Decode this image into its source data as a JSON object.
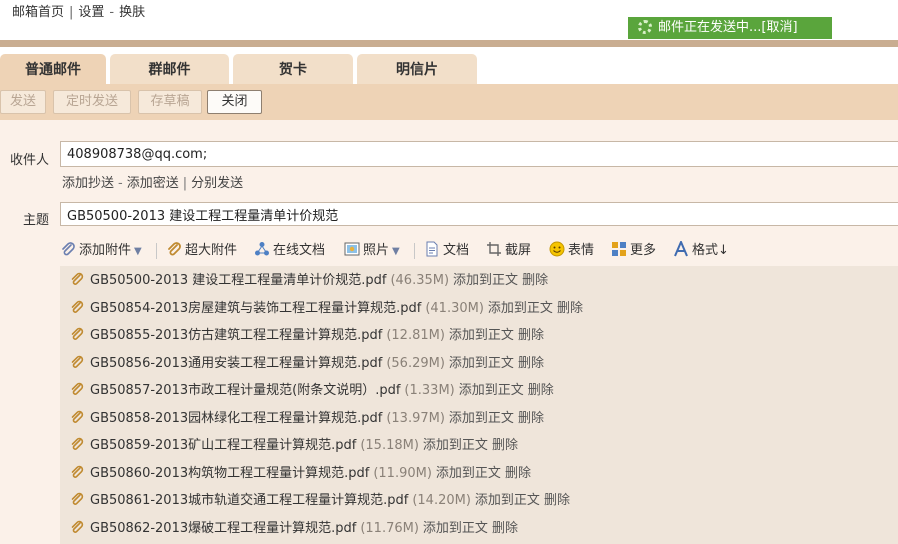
{
  "header": {
    "links": [
      {
        "label": "邮箱首页"
      },
      {
        "label": "设置"
      },
      {
        "label": "换肤"
      }
    ],
    "sep1": "|",
    "sep2": "-",
    "sending_text": "邮件正在发送中...",
    "cancel_label": "[取消]"
  },
  "tabs": [
    {
      "label": "普通邮件",
      "active": true
    },
    {
      "label": "群邮件"
    },
    {
      "label": "贺卡"
    },
    {
      "label": "明信片"
    }
  ],
  "toolbar": {
    "send": "发送",
    "scheduled_send": "定时发送",
    "save_draft": "存草稿",
    "close": "关闭"
  },
  "compose": {
    "to_label": "收件人",
    "to_value": "408908738@qq.com;",
    "add_cc": "添加抄送",
    "add_bcc": "添加密送",
    "separate_send": "分别发送",
    "link_sep_dash": "-",
    "link_sep_bar": "|",
    "subject_label": "主题",
    "subject_value": "GB50500-2013 建设工程工程量清单计价规范"
  },
  "attach_toolbar": {
    "add_attachment": "添加附件",
    "large_attachment": "超大附件",
    "online_docs": "在线文档",
    "photo": "照片",
    "document": "文档",
    "screenshot": "截屏",
    "emoji": "表情",
    "more": "更多",
    "format": "格式↓"
  },
  "attachments": {
    "add_to_body": "添加到正文",
    "delete": "删除",
    "items": [
      {
        "name": "GB50500-2013 建设工程工程量清单计价规范.pdf",
        "size": "(46.35M)"
      },
      {
        "name": "GB50854-2013房屋建筑与装饰工程工程量计算规范.pdf",
        "size": "(41.30M)"
      },
      {
        "name": "GB50855-2013仿古建筑工程工程量计算规范.pdf",
        "size": "(12.81M)"
      },
      {
        "name": "GB50856-2013通用安装工程工程量计算规范.pdf",
        "size": "(56.29M)"
      },
      {
        "name": "GB50857-2013市政工程计量规范(附条文说明）.pdf",
        "size": "(1.33M)"
      },
      {
        "name": "GB50858-2013园林绿化工程工程量计算规范.pdf",
        "size": "(13.97M)"
      },
      {
        "name": "GB50859-2013矿山工程工程量计算规范.pdf",
        "size": "(15.18M)"
      },
      {
        "name": "GB50860-2013构筑物工程工程量计算规范.pdf",
        "size": "(11.90M)"
      },
      {
        "name": "GB50861-2013城市轨道交通工程工程量计算规范.pdf",
        "size": "(14.20M)"
      },
      {
        "name": "GB50862-2013爆破工程工程量计算规范.pdf",
        "size": "(11.76M)"
      }
    ]
  },
  "colors": {
    "accent_bar": "#c9ad91",
    "tab_active": "#eed3b6",
    "sending_green": "#5aa53c"
  }
}
